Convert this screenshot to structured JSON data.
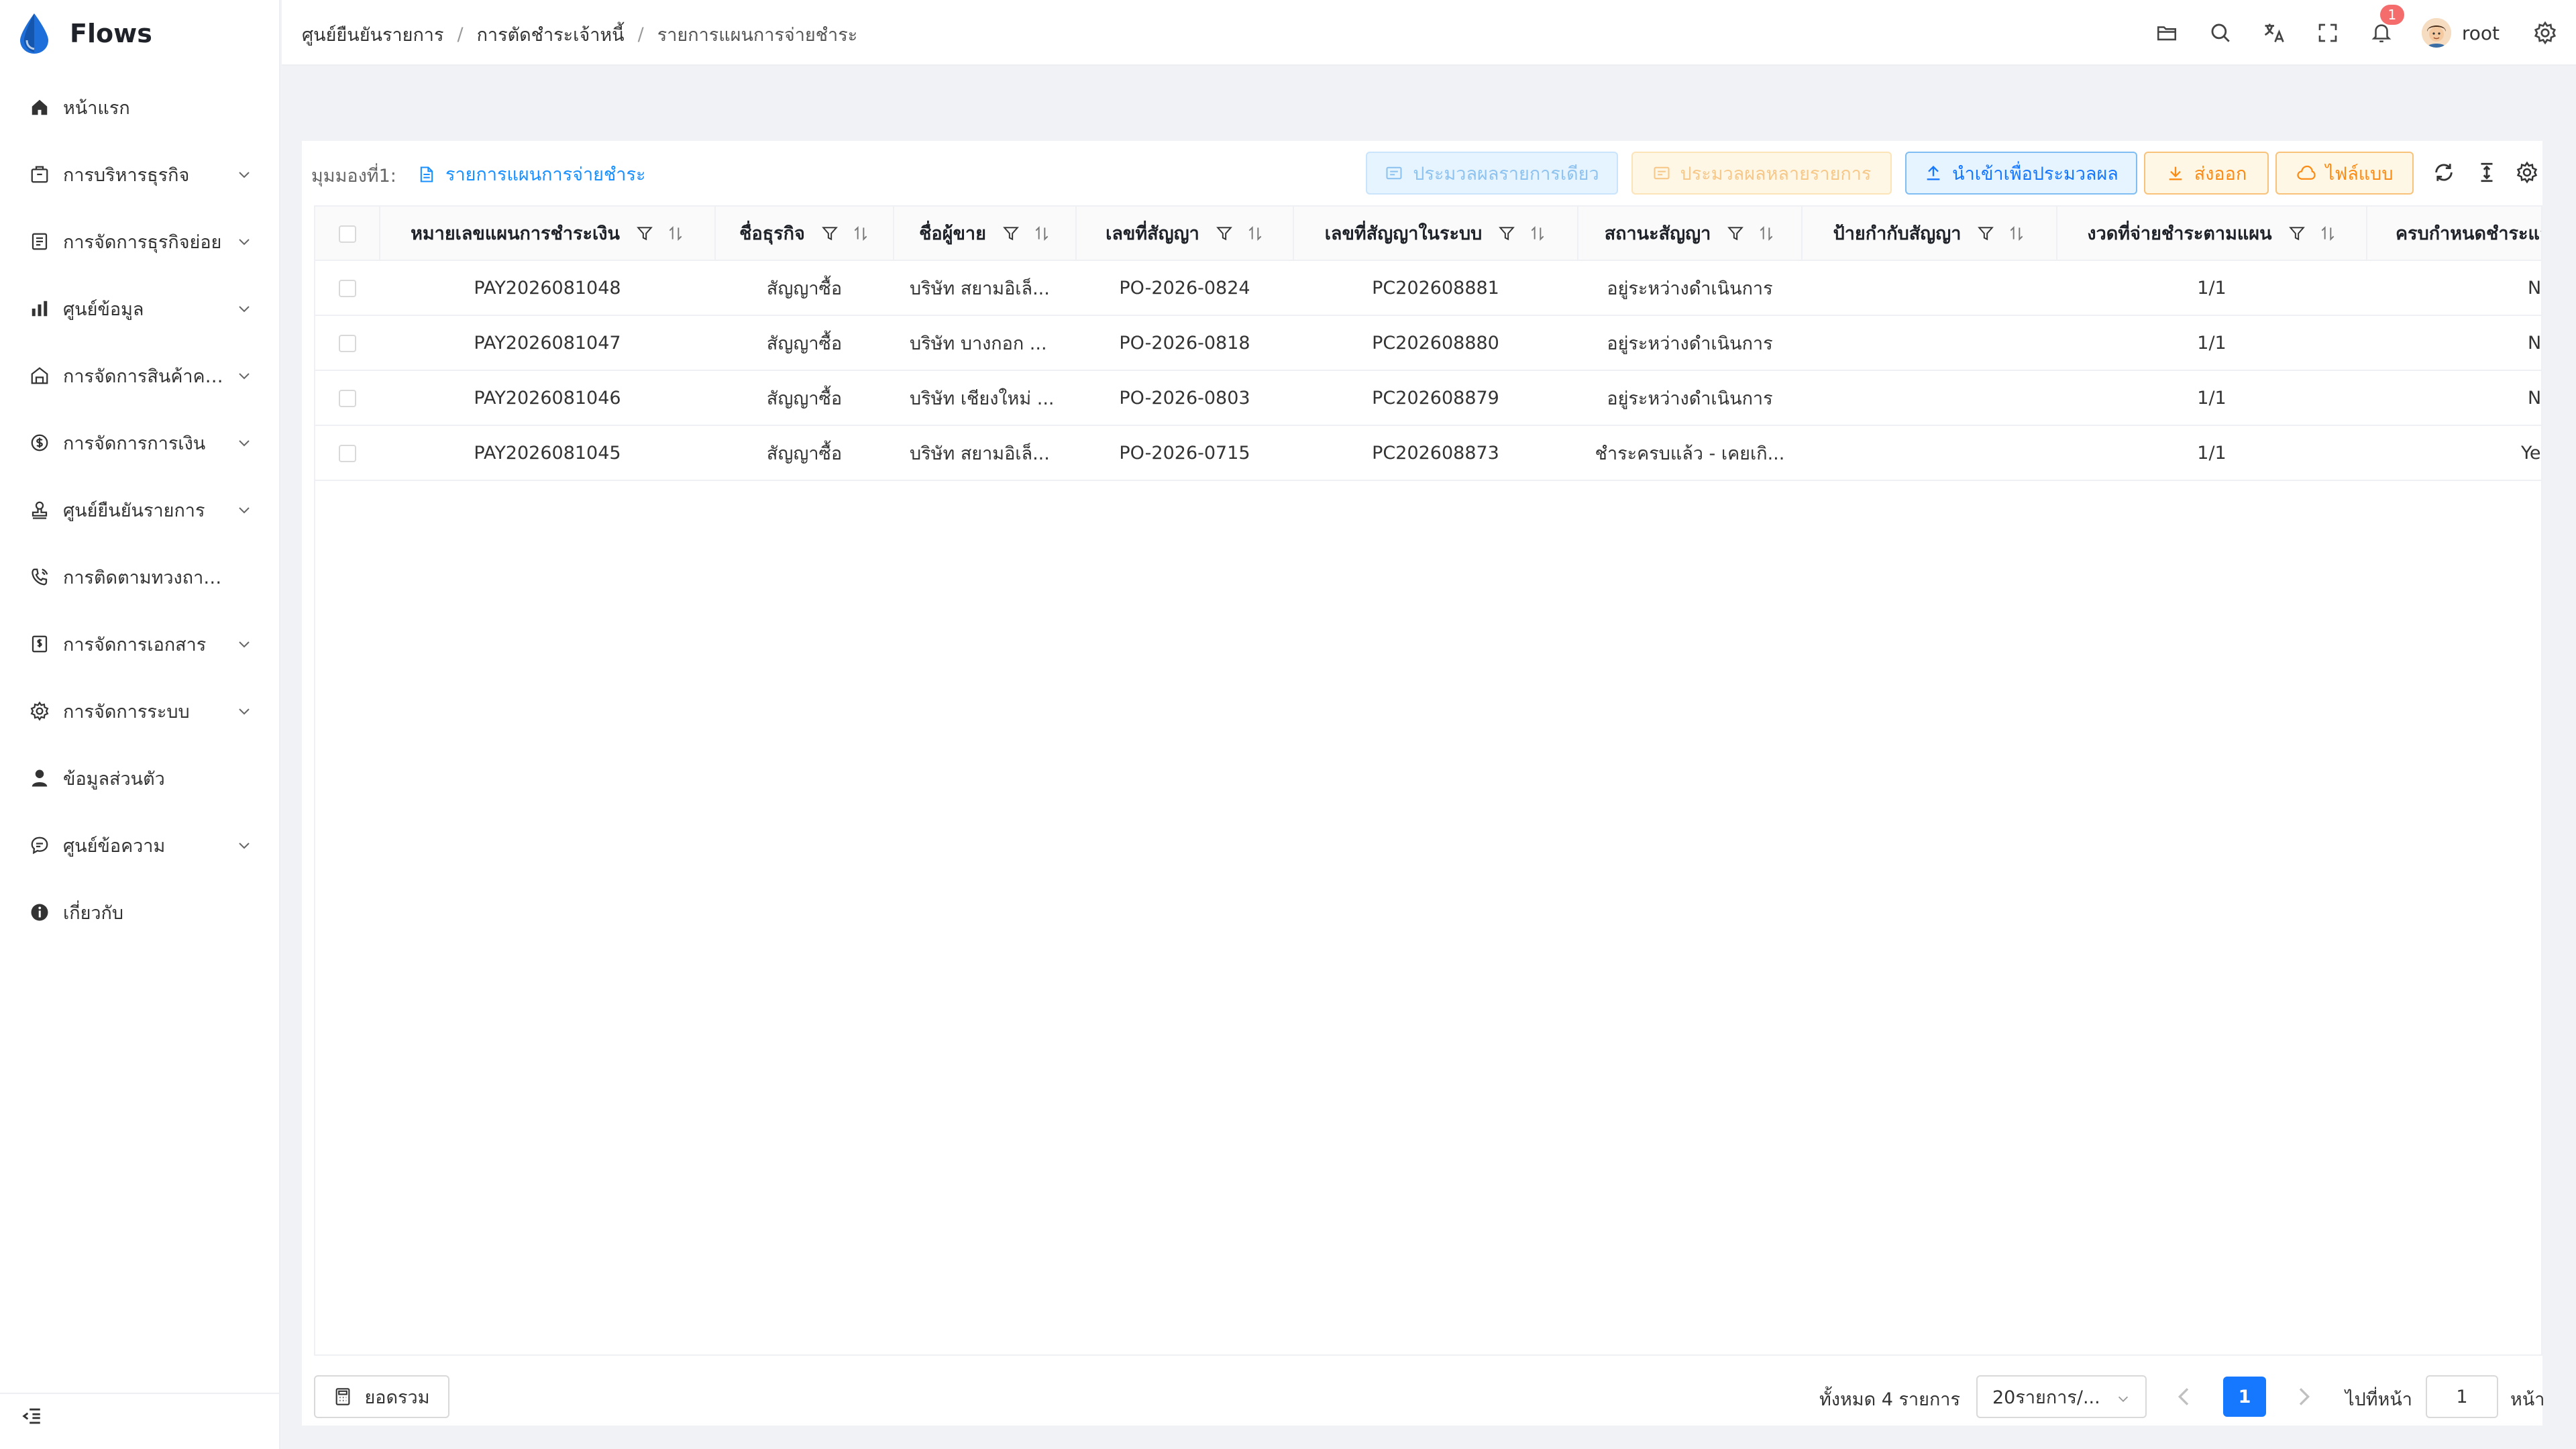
{
  "app": {
    "name": "Flows"
  },
  "sidebar": {
    "items": [
      {
        "label": "หน้าแรก",
        "icon": "home-icon",
        "expandable": false
      },
      {
        "label": "การบริหารธุรกิจ",
        "icon": "briefcase-icon",
        "expandable": true
      },
      {
        "label": "การจัดการธุรกิจย่อย",
        "icon": "document-list-icon",
        "expandable": true
      },
      {
        "label": "ศูนย์ข้อมูล",
        "icon": "bar-chart-icon",
        "expandable": true
      },
      {
        "label": "การจัดการสินค้าคง...",
        "icon": "warehouse-icon",
        "expandable": true
      },
      {
        "label": "การจัดการการเงิน",
        "icon": "money-icon",
        "expandable": true
      },
      {
        "label": "ศูนย์ยืนยันรายการ",
        "icon": "stamp-icon",
        "expandable": true
      },
      {
        "label": "การติดตามทวงถามหนี้",
        "icon": "phone-call-icon",
        "expandable": false
      },
      {
        "label": "การจัดการเอกสาร",
        "icon": "invoice-icon",
        "expandable": true
      },
      {
        "label": "การจัดการระบบ",
        "icon": "gear-icon",
        "expandable": true
      },
      {
        "label": "ข้อมูลส่วนตัว",
        "icon": "user-icon",
        "expandable": false
      },
      {
        "label": "ศูนย์ข้อความ",
        "icon": "message-icon",
        "expandable": true
      },
      {
        "label": "เกี่ยวกับ",
        "icon": "info-icon",
        "expandable": false
      }
    ]
  },
  "header": {
    "breadcrumb": [
      "ศูนย์ยืนยันรายการ",
      "การตัดชำระเจ้าหนี้",
      "รายการแผนการจ่ายชำระ"
    ],
    "notification_count": "1",
    "user_name": "root"
  },
  "toolbar": {
    "view_label": "มุมมองที่1:",
    "view_tab": "รายการแผนการจ่ายชำระ",
    "btn_single": "ประมวลผลรายการเดียว",
    "btn_multi": "ประมวลผลหลายรายการ",
    "btn_import": "นำเข้าเพื่อประมวลผล",
    "btn_export": "ส่งออก",
    "btn_template": "ไฟล์แบบ"
  },
  "table": {
    "columns": [
      "หมายเลขแผนการชำระเงิน",
      "ชื่อธุรกิจ",
      "ชื่อผู้ขาย",
      "เลขที่สัญญา",
      "เลขที่สัญญาในระบบ",
      "สถานะสัญญา",
      "ป้ายกำกับสัญญา",
      "งวดที่จ่ายชำระตามแผน",
      "ครบกำหนดชำระแล้ว"
    ],
    "rows": [
      [
        "PAY2026081048",
        "สัญญาซื้อ",
        "บริษัท สยามอิเล็...",
        "PO-2026-0824",
        "PC202608881",
        "อยู่ระหว่างดำเนินการ",
        "",
        "1/1",
        "No"
      ],
      [
        "PAY2026081047",
        "สัญญาซื้อ",
        "บริษัท บางกอก ...",
        "PO-2026-0818",
        "PC202608880",
        "อยู่ระหว่างดำเนินการ",
        "",
        "1/1",
        "No"
      ],
      [
        "PAY2026081046",
        "สัญญาซื้อ",
        "บริษัท เชียงใหม่ ...",
        "PO-2026-0803",
        "PC202608879",
        "อยู่ระหว่างดำเนินการ",
        "",
        "1/1",
        "No"
      ],
      [
        "PAY2026081045",
        "สัญญาซื้อ",
        "บริษัท สยามอิเล็...",
        "PO-2026-0715",
        "PC202608873",
        "ชำระครบแล้ว - เคยเกิ...",
        "",
        "1/1",
        "Yes"
      ]
    ]
  },
  "footer": {
    "total_button": "ยอดรวม",
    "total_text": "ทั้งหมด 4 รายการ",
    "page_size": "20รายการ/...",
    "current_page": "1",
    "goto_label": "ไปที่หน้า",
    "goto_value": "1",
    "goto_suffix": "หน้า"
  },
  "colors": {
    "primary": "#1677ff",
    "warning": "#fa8c16",
    "danger": "#f56c6c"
  }
}
